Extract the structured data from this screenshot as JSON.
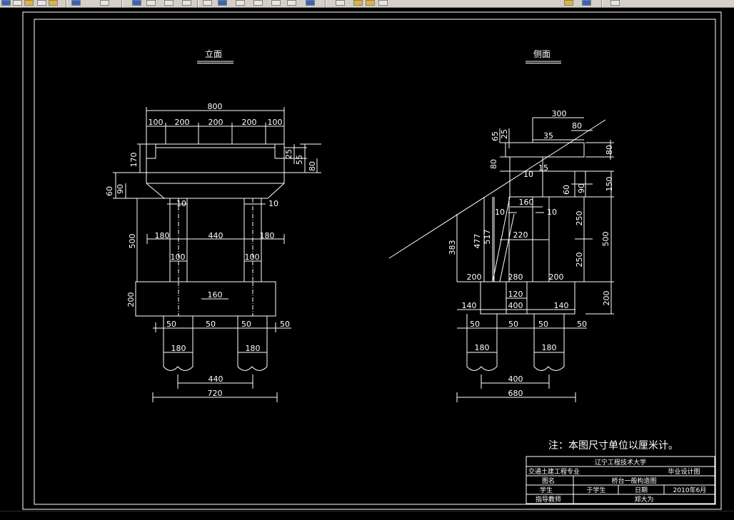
{
  "colors": {
    "background": "#000000",
    "lines": "#ffffff",
    "toolbar": "#d4d0c8"
  },
  "drawing": {
    "front_view": {
      "title": "立面",
      "dims": {
        "top_total": "800",
        "seg_a": "100",
        "seg_b": "200",
        "seg_c": "200",
        "seg_d": "200",
        "seg_e": "100",
        "cap_height": "170",
        "right_25": "25",
        "right_55": "55",
        "right_80": "80",
        "left_60": "60",
        "left_90": "90",
        "col_gap_left": "10",
        "col_gap_right": "10",
        "pier_height": "500",
        "col_left_off": "180",
        "col_spacing": "440",
        "col_right_off": "180",
        "col_width_left": "100",
        "col_width_right": "100",
        "footing_height": "200",
        "footing_inner": "160",
        "pile_off1": "50",
        "pile_off2": "50",
        "pile_off3": "50",
        "pile_off4": "50",
        "pile_dia_left": "180",
        "pile_dia_right": "180",
        "pile_spacing": "440",
        "footing_total": "720"
      }
    },
    "side_view": {
      "title": "侧面",
      "dims": {
        "top_300": "300",
        "top_80": "80",
        "top_35": "35",
        "left_65": "65",
        "left_25": "25",
        "right_80a": "80",
        "left_80": "80",
        "mid_10": "10",
        "mid_15": "15",
        "right_60": "60",
        "right_90": "90",
        "right_150": "150",
        "cap_160": "160",
        "off_10a": "10",
        "off_10b": "10",
        "h_383": "383",
        "h_477": "477",
        "h_517": "517",
        "w_220": "220",
        "h_250a": "250",
        "h_250b": "250",
        "h_500": "500",
        "w_200a": "200",
        "w_280": "280",
        "w_200b": "200",
        "w_120": "120",
        "w_140a": "140",
        "w_400a": "400",
        "w_140b": "140",
        "footing_200": "200",
        "p_50a": "50",
        "p_50b": "50",
        "p_50c": "50",
        "p_50d": "50",
        "pile_180a": "180",
        "pile_180b": "180",
        "w_400b": "400",
        "w_680": "680"
      }
    },
    "note": "注：本图尺寸单位以厘米计。",
    "title_block": {
      "school": "辽宁工程技术大学",
      "major": "交通土建工程专业",
      "doc_type": "毕业设计图",
      "drawing_label": "图名",
      "drawing_name": "桥台一般构造图",
      "student_label": "学生",
      "student_name": "于学生",
      "date_label": "日期",
      "date_value": "2010年6月",
      "advisor_label": "指导教师",
      "advisor_name": "郑大为"
    }
  }
}
